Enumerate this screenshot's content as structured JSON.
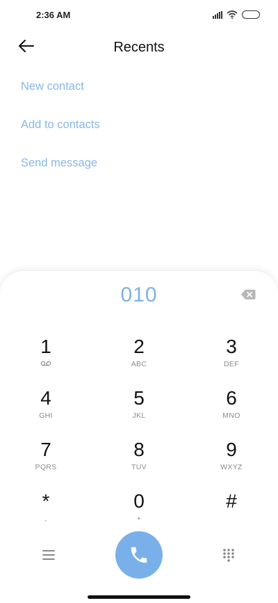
{
  "status_bar": {
    "time": "2:36 AM",
    "icons": [
      "signal-icon",
      "wifi-icon",
      "battery-icon"
    ]
  },
  "header": {
    "title": "Recents",
    "back_icon": "back-arrow-icon"
  },
  "actions": [
    {
      "label": "New contact"
    },
    {
      "label": "Add to contacts"
    },
    {
      "label": "Send message"
    }
  ],
  "dialer": {
    "number": "010",
    "backspace_icon": "backspace-icon",
    "keys": [
      {
        "digit": "1",
        "letters": ""
      },
      {
        "digit": "2",
        "letters": "ABC"
      },
      {
        "digit": "3",
        "letters": "DEF"
      },
      {
        "digit": "4",
        "letters": "GHI"
      },
      {
        "digit": "5",
        "letters": "JKL"
      },
      {
        "digit": "6",
        "letters": "MNO"
      },
      {
        "digit": "7",
        "letters": "PQRS"
      },
      {
        "digit": "8",
        "letters": "TUV"
      },
      {
        "digit": "9",
        "letters": "WXYZ"
      },
      {
        "digit": "*",
        "letters": ","
      },
      {
        "digit": "0",
        "letters": "+"
      },
      {
        "digit": "#",
        "letters": ""
      }
    ],
    "bottom": {
      "menu_icon": "menu-icon",
      "call_icon": "phone-icon",
      "dialpad_icon": "dialpad-grid-icon"
    }
  },
  "colors": {
    "accent": "#79b0ea",
    "link": "#8ab6e6",
    "number": "#7fb2e5"
  }
}
